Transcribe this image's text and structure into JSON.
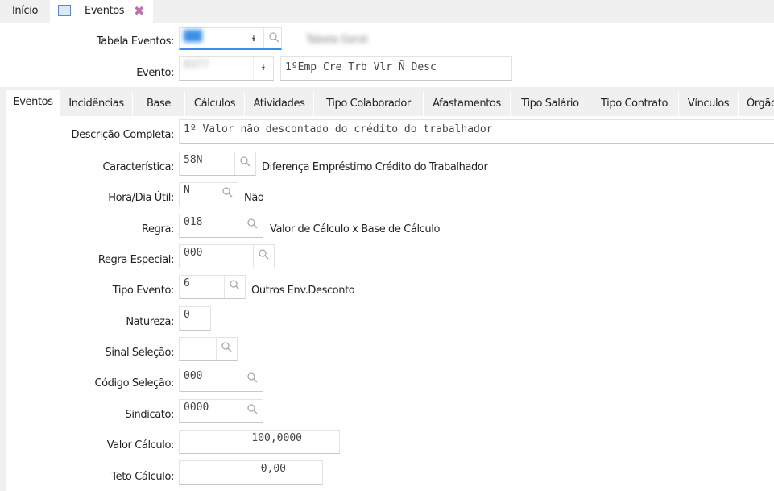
{
  "top_tabs": {
    "home": "Início",
    "eventos": "Eventos"
  },
  "header": {
    "tabela_label": "Tabela Eventos:",
    "tabela_value": "001",
    "tabela_desc": "Tabela Geral",
    "evento_label": "Evento:",
    "evento_value": "0377",
    "evento_desc": "1ºEmp Cre Trb Vlr Ñ Desc"
  },
  "tabs": [
    "Eventos",
    "Incidências",
    "Base",
    "Cálculos",
    "Atividades",
    "Tipo Colaborador",
    "Afastamentos",
    "Tipo Salário",
    "Tipo Contrato",
    "Vínculos",
    "Órgão"
  ],
  "form": {
    "descricao": {
      "label": "Descrição Completa:",
      "value": "1º Valor não descontado do crédito do trabalhador"
    },
    "caracteristica": {
      "label": "Característica:",
      "value": "58N",
      "desc": "Diferença Empréstimo Crédito do Trabalhador"
    },
    "hora": {
      "label": "Hora/Dia Útil:",
      "value": "N",
      "desc": "Não"
    },
    "regra": {
      "label": "Regra:",
      "value": "018",
      "desc": "Valor de Cálculo x Base de Cálculo"
    },
    "regra_especial": {
      "label": "Regra Especial:",
      "value": "000"
    },
    "tipo_evento": {
      "label": "Tipo Evento:",
      "value": "6",
      "desc": "Outros Env.Desconto"
    },
    "natureza": {
      "label": "Natureza:",
      "value": "0"
    },
    "sinal": {
      "label": "Sinal Seleção:",
      "value": ""
    },
    "codigo": {
      "label": "Código Seleção:",
      "value": "000"
    },
    "sindicato": {
      "label": "Sindicato:",
      "value": "0000"
    },
    "valor": {
      "label": "Valor Cálculo:",
      "value": "100,0000"
    },
    "teto": {
      "label": "Teto Cálculo:",
      "value": "0,00"
    }
  }
}
